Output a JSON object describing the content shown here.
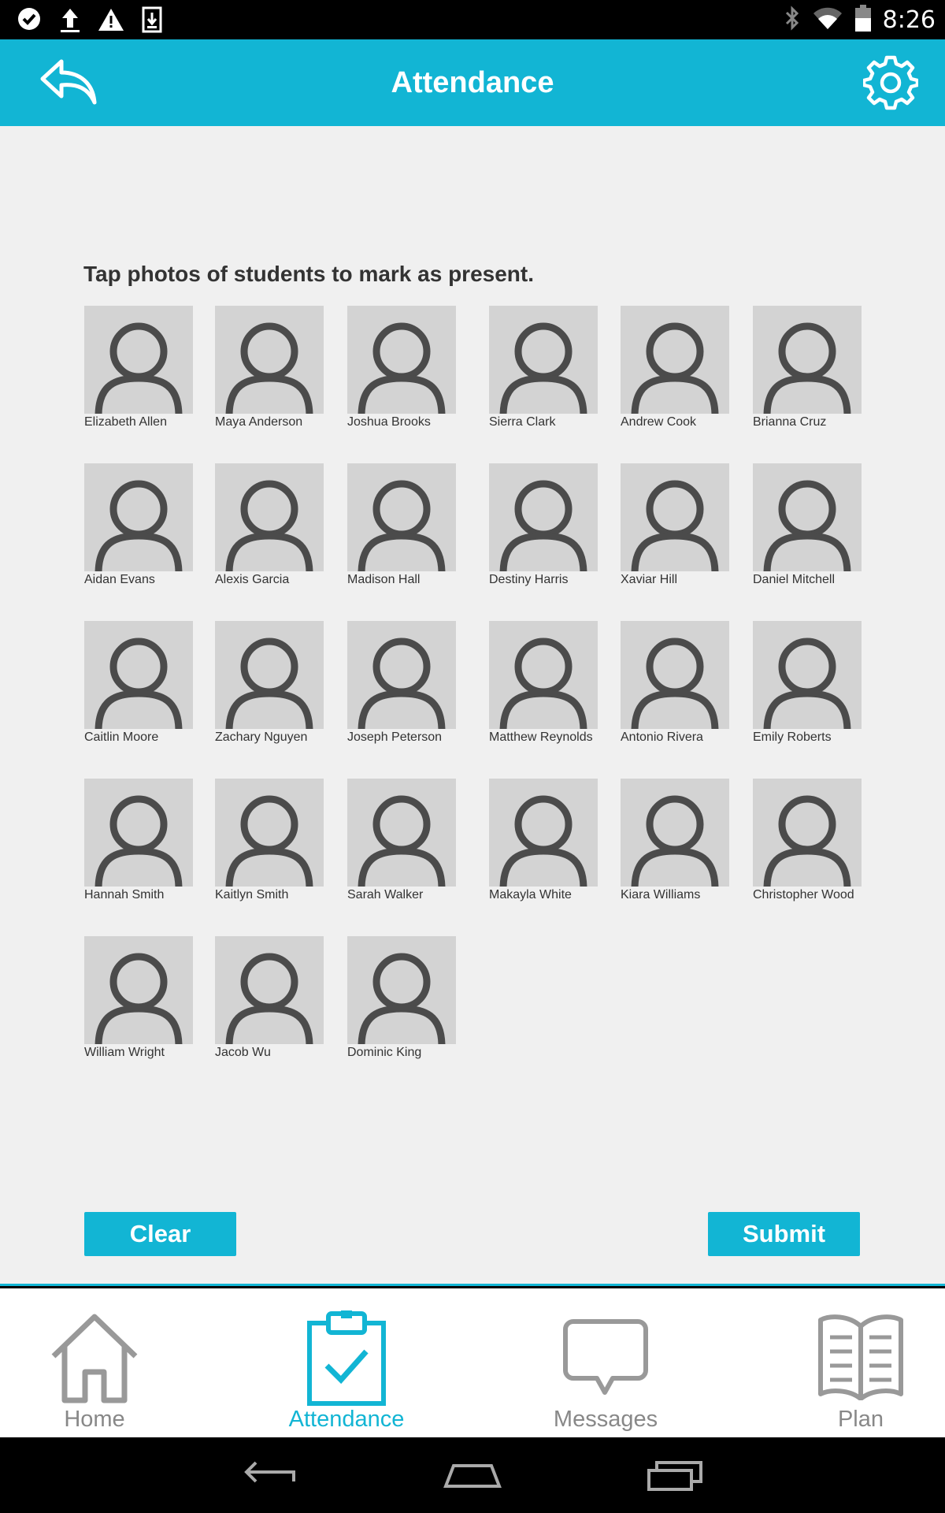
{
  "status_bar": {
    "time": "8:26"
  },
  "header": {
    "title": "Attendance"
  },
  "instruction": "Tap photos of students to mark as present.",
  "students": [
    "Elizabeth Allen",
    "Maya Anderson",
    "Joshua Brooks",
    "Sierra Clark",
    "Andrew Cook",
    "Brianna Cruz",
    "Aidan Evans",
    "Alexis Garcia",
    "Madison Hall",
    "Destiny Harris",
    "Xaviar Hill",
    "Daniel Mitchell",
    "Caitlin Moore",
    "Zachary Nguyen",
    "Joseph Peterson",
    "Matthew Reynolds",
    "Antonio Rivera",
    "Emily Roberts",
    "Hannah Smith",
    "Kaitlyn Smith",
    "Sarah Walker",
    "Makayla White",
    "Kiara Williams",
    "Christopher Wood",
    "William Wright",
    "Jacob Wu",
    "Dominic King"
  ],
  "buttons": {
    "clear": "Clear",
    "submit": "Submit"
  },
  "nav": [
    {
      "label": "Home",
      "icon": "home-icon",
      "active": false
    },
    {
      "label": "Attendance",
      "icon": "clipboard-check-icon",
      "active": true
    },
    {
      "label": "Messages",
      "icon": "speech-bubble-icon",
      "active": false
    },
    {
      "label": "Plan",
      "icon": "book-icon",
      "active": false
    }
  ],
  "colors": {
    "accent": "#12b5d4",
    "background": "#f0f0f0",
    "photo_placeholder": "#d3d3d3",
    "inactive": "#888888"
  }
}
